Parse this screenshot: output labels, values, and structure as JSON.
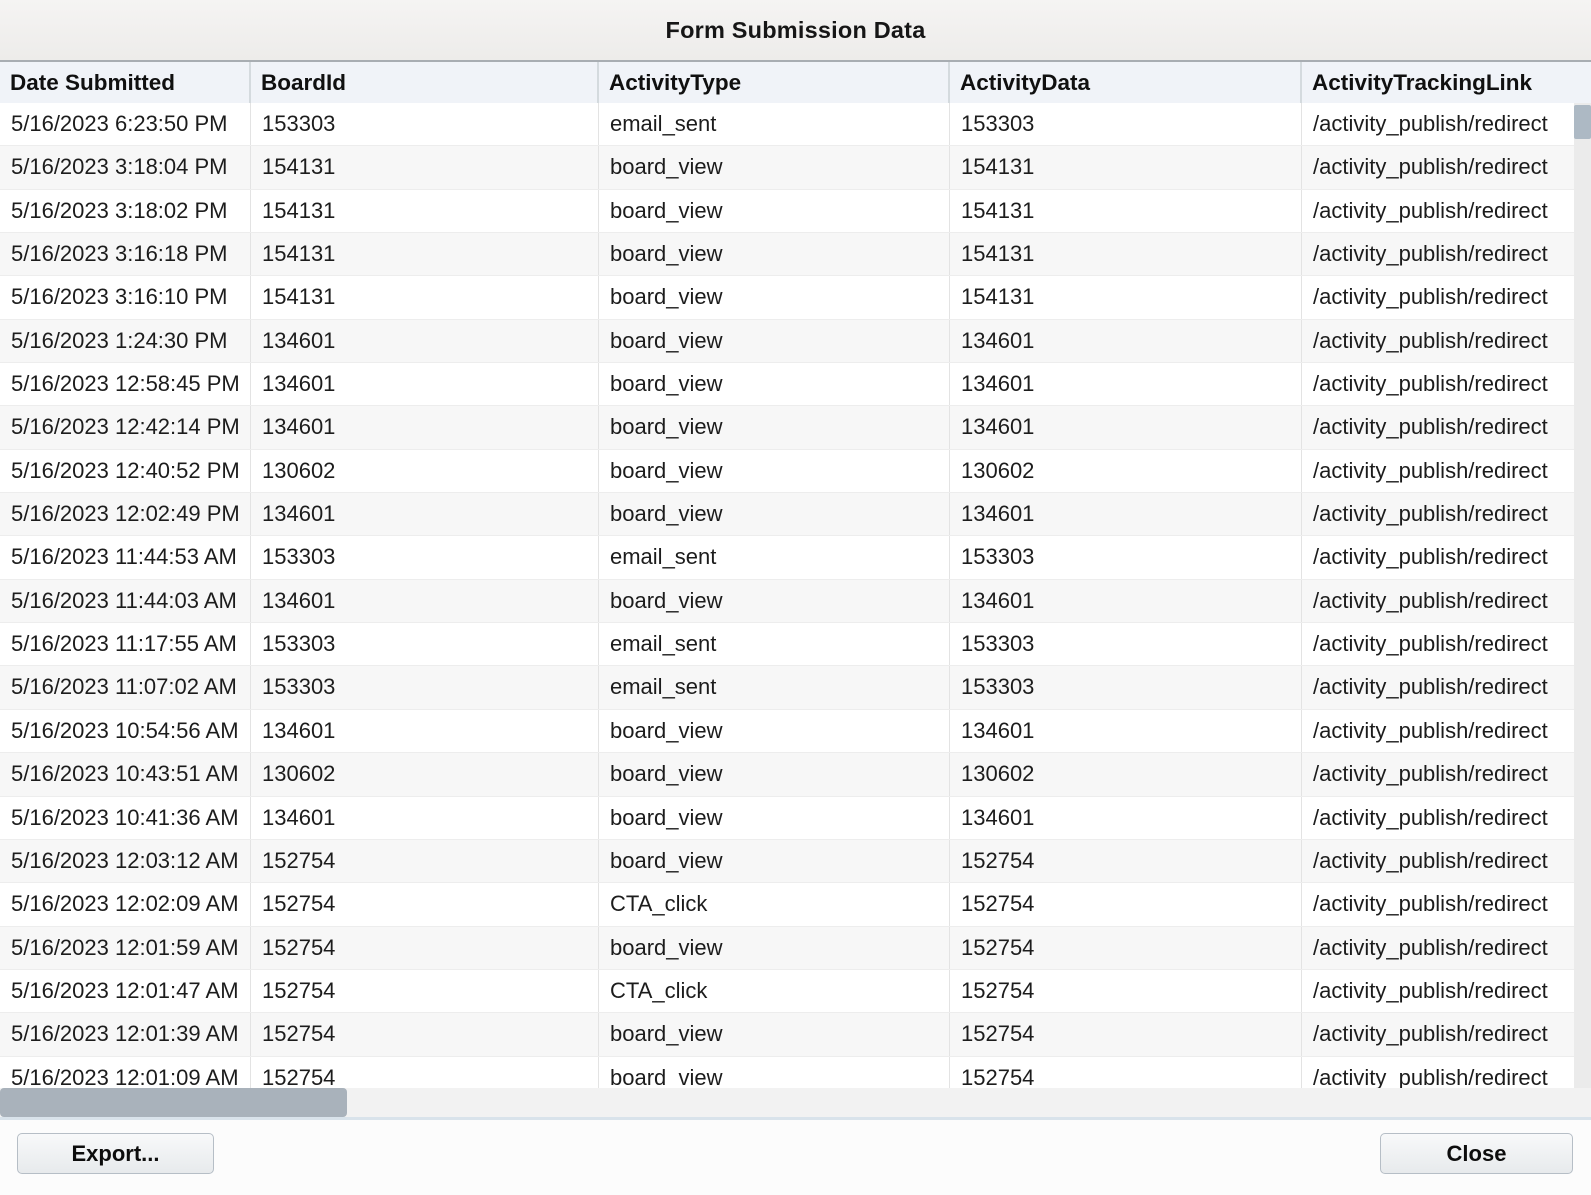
{
  "dialog": {
    "title": "Form Submission Data"
  },
  "table": {
    "columns": [
      {
        "id": "date_submitted",
        "label": "Date Submitted"
      },
      {
        "id": "board_id",
        "label": "BoardId"
      },
      {
        "id": "activity_type",
        "label": "ActivityType"
      },
      {
        "id": "activity_data",
        "label": "ActivityData"
      },
      {
        "id": "activity_tracking_link",
        "label": "ActivityTrackingLink"
      }
    ],
    "rows": [
      {
        "date_submitted": "5/16/2023 6:23:50 PM",
        "board_id": "153303",
        "activity_type": "email_sent",
        "activity_data": "153303",
        "activity_tracking_link": "/activity_publish/redirect"
      },
      {
        "date_submitted": "5/16/2023 3:18:04 PM",
        "board_id": "154131",
        "activity_type": "board_view",
        "activity_data": "154131",
        "activity_tracking_link": "/activity_publish/redirect"
      },
      {
        "date_submitted": "5/16/2023 3:18:02 PM",
        "board_id": "154131",
        "activity_type": "board_view",
        "activity_data": "154131",
        "activity_tracking_link": "/activity_publish/redirect"
      },
      {
        "date_submitted": "5/16/2023 3:16:18 PM",
        "board_id": "154131",
        "activity_type": "board_view",
        "activity_data": "154131",
        "activity_tracking_link": "/activity_publish/redirect"
      },
      {
        "date_submitted": "5/16/2023 3:16:10 PM",
        "board_id": "154131",
        "activity_type": "board_view",
        "activity_data": "154131",
        "activity_tracking_link": "/activity_publish/redirect"
      },
      {
        "date_submitted": "5/16/2023 1:24:30 PM",
        "board_id": "134601",
        "activity_type": "board_view",
        "activity_data": "134601",
        "activity_tracking_link": "/activity_publish/redirect"
      },
      {
        "date_submitted": "5/16/2023 12:58:45 PM",
        "board_id": "134601",
        "activity_type": "board_view",
        "activity_data": "134601",
        "activity_tracking_link": "/activity_publish/redirect"
      },
      {
        "date_submitted": "5/16/2023 12:42:14 PM",
        "board_id": "134601",
        "activity_type": "board_view",
        "activity_data": "134601",
        "activity_tracking_link": "/activity_publish/redirect"
      },
      {
        "date_submitted": "5/16/2023 12:40:52 PM",
        "board_id": "130602",
        "activity_type": "board_view",
        "activity_data": "130602",
        "activity_tracking_link": "/activity_publish/redirect"
      },
      {
        "date_submitted": "5/16/2023 12:02:49 PM",
        "board_id": "134601",
        "activity_type": "board_view",
        "activity_data": "134601",
        "activity_tracking_link": "/activity_publish/redirect"
      },
      {
        "date_submitted": "5/16/2023 11:44:53 AM",
        "board_id": "153303",
        "activity_type": "email_sent",
        "activity_data": "153303",
        "activity_tracking_link": "/activity_publish/redirect"
      },
      {
        "date_submitted": "5/16/2023 11:44:03 AM",
        "board_id": "134601",
        "activity_type": "board_view",
        "activity_data": "134601",
        "activity_tracking_link": "/activity_publish/redirect"
      },
      {
        "date_submitted": "5/16/2023 11:17:55 AM",
        "board_id": "153303",
        "activity_type": "email_sent",
        "activity_data": "153303",
        "activity_tracking_link": "/activity_publish/redirect"
      },
      {
        "date_submitted": "5/16/2023 11:07:02 AM",
        "board_id": "153303",
        "activity_type": "email_sent",
        "activity_data": "153303",
        "activity_tracking_link": "/activity_publish/redirect"
      },
      {
        "date_submitted": "5/16/2023 10:54:56 AM",
        "board_id": "134601",
        "activity_type": "board_view",
        "activity_data": "134601",
        "activity_tracking_link": "/activity_publish/redirect"
      },
      {
        "date_submitted": "5/16/2023 10:43:51 AM",
        "board_id": "130602",
        "activity_type": "board_view",
        "activity_data": "130602",
        "activity_tracking_link": "/activity_publish/redirect"
      },
      {
        "date_submitted": "5/16/2023 10:41:36 AM",
        "board_id": "134601",
        "activity_type": "board_view",
        "activity_data": "134601",
        "activity_tracking_link": "/activity_publish/redirect"
      },
      {
        "date_submitted": "5/16/2023 12:03:12 AM",
        "board_id": "152754",
        "activity_type": "board_view",
        "activity_data": "152754",
        "activity_tracking_link": "/activity_publish/redirect"
      },
      {
        "date_submitted": "5/16/2023 12:02:09 AM",
        "board_id": "152754",
        "activity_type": "CTA_click",
        "activity_data": "152754",
        "activity_tracking_link": "/activity_publish/redirect"
      },
      {
        "date_submitted": "5/16/2023 12:01:59 AM",
        "board_id": "152754",
        "activity_type": "board_view",
        "activity_data": "152754",
        "activity_tracking_link": "/activity_publish/redirect"
      },
      {
        "date_submitted": "5/16/2023 12:01:47 AM",
        "board_id": "152754",
        "activity_type": "CTA_click",
        "activity_data": "152754",
        "activity_tracking_link": "/activity_publish/redirect"
      },
      {
        "date_submitted": "5/16/2023 12:01:39 AM",
        "board_id": "152754",
        "activity_type": "board_view",
        "activity_data": "152754",
        "activity_tracking_link": "/activity_publish/redirect"
      },
      {
        "date_submitted": "5/16/2023 12:01:09 AM",
        "board_id": "152754",
        "activity_type": "board_view",
        "activity_data": "152754",
        "activity_tracking_link": "/activity_publish/redirect"
      }
    ]
  },
  "scroll_state": {
    "vertical_thumb": "top",
    "horizontal_thumb": "left"
  },
  "footer": {
    "export_label": "Export...",
    "close_label": "Close"
  },
  "colors": {
    "header_bg": "#f0f3f8",
    "title_bg": "#f0efee",
    "row_alt_bg": "#f7f7f7",
    "scroll_thumb": "#a9b2bb",
    "footer_divider": "#d9e3eb"
  }
}
